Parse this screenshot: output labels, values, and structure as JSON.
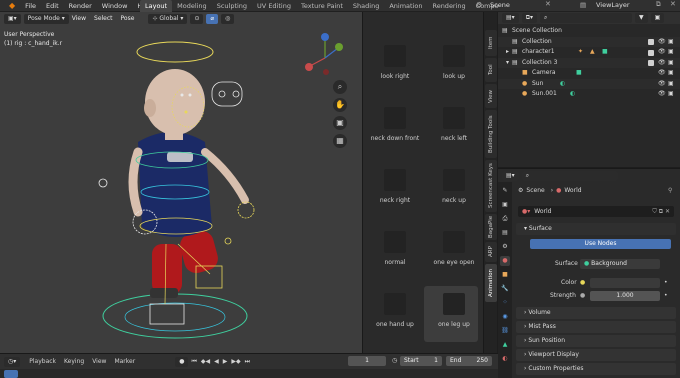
{
  "topbar": {
    "menu": [
      "File",
      "Edit",
      "Render",
      "Window",
      "Help"
    ],
    "workspaces": [
      "Layout",
      "Modeling",
      "Sculpting",
      "UV Editing",
      "Texture Paint",
      "Shading",
      "Animation",
      "Rendering",
      "Compo"
    ],
    "active_workspace": "Layout",
    "scene": "Scene",
    "view_layer": "ViewLayer"
  },
  "viewport": {
    "mode": "Pose Mode",
    "menus": [
      "View",
      "Select",
      "Pose"
    ],
    "orientation": "Global",
    "perspective_label": "User Perspective",
    "active_label": "(1) rig : c_hand_ik.r"
  },
  "pose_library": {
    "poses": [
      {
        "label": "look right"
      },
      {
        "label": "look up"
      },
      {
        "label": "neck down front"
      },
      {
        "label": "neck left"
      },
      {
        "label": "neck right"
      },
      {
        "label": "neck up"
      },
      {
        "label": "normal"
      },
      {
        "label": "one eye open"
      },
      {
        "label": "one hand up"
      },
      {
        "label": "one leg up"
      }
    ],
    "active_pose": "one leg up"
  },
  "side_tabs": [
    "Item",
    "Tool",
    "View",
    "Building Tools",
    "Screencast Keys",
    "BagaPie",
    "ARP",
    "Animation"
  ],
  "outliner": {
    "rows": [
      {
        "label": "Scene Collection",
        "indent": 0
      },
      {
        "label": "Collection",
        "indent": 1
      },
      {
        "label": "character1",
        "indent": 1
      },
      {
        "label": "Collection 3",
        "indent": 1
      },
      {
        "label": "Camera",
        "indent": 2
      },
      {
        "label": "Sun",
        "indent": 2
      },
      {
        "label": "Sun.001",
        "indent": 2
      }
    ]
  },
  "properties": {
    "breadcrumb_scene": "Scene",
    "breadcrumb_world": "World",
    "world_name": "World",
    "surface_panel": "Surface",
    "use_nodes_button": "Use Nodes",
    "surface_label": "Surface",
    "surface_value": "Background",
    "color_label": "Color",
    "strength_label": "Strength",
    "strength_value": "1.000",
    "collapsed_panels": [
      "Volume",
      "Mist Pass",
      "Sun Position",
      "Viewport Display",
      "Custom Properties"
    ]
  },
  "timeline": {
    "menus": [
      "Playback",
      "Keying",
      "View",
      "Marker"
    ],
    "current_frame": "1",
    "start_label": "Start",
    "start_value": "1",
    "end_label": "End",
    "end_value": "250"
  },
  "colors": {
    "accent": "#4772b3",
    "viewport_bg": "#3d3d3d",
    "shirt": "#1b2a66",
    "pants": "#b0191c",
    "skin": "#d8bfae",
    "rig_yellow": "#e8d85a",
    "rig_green": "#3fcf9e",
    "rig_cyan": "#38c7e0"
  }
}
